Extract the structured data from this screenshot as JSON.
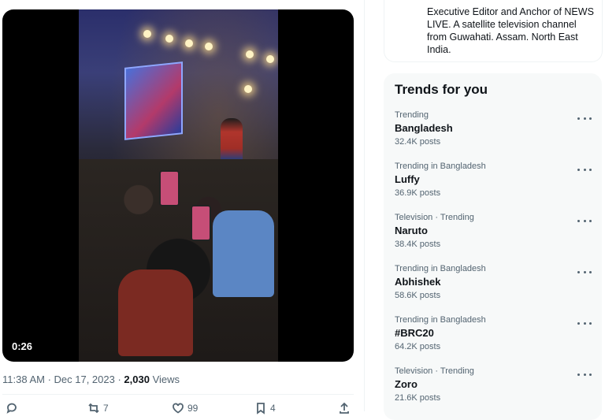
{
  "tweet": {
    "video_duration": "0:26",
    "timestamp": "11:38 AM · Dec 17, 2023 · ",
    "views_count": "2,030",
    "views_label": " Views",
    "actions": {
      "reply_count": "",
      "retweet_count": "7",
      "like_count": "99",
      "bookmark_count": "4"
    }
  },
  "bio": {
    "text": "Executive Editor and Anchor of NEWS LIVE. A satellite television channel from Guwahati. Assam. North East India."
  },
  "trends": {
    "title": "Trends for you",
    "items": [
      {
        "context": "Trending",
        "name": "Bangladesh",
        "count": "32.4K posts"
      },
      {
        "context": "Trending in Bangladesh",
        "name": "Luffy",
        "count": "36.9K posts"
      },
      {
        "context": "Television · Trending",
        "name": "Naruto",
        "count": "38.4K posts"
      },
      {
        "context": "Trending in Bangladesh",
        "name": "Abhishek",
        "count": "58.6K posts"
      },
      {
        "context": "Trending in Bangladesh",
        "name": "#BRC20",
        "count": "64.2K posts"
      },
      {
        "context": "Television · Trending",
        "name": "Zoro",
        "count": "21.6K posts"
      }
    ]
  }
}
